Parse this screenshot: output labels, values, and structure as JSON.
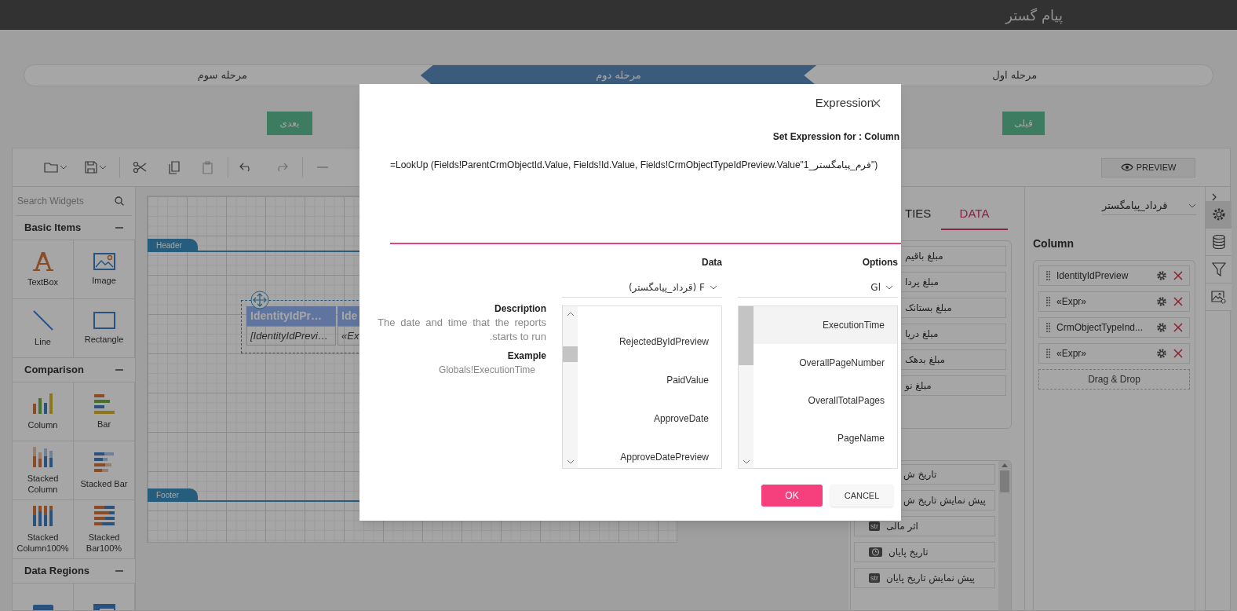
{
  "app_title": "پیام گستر",
  "steps": [
    {
      "label": "مرحله اول",
      "selected": false
    },
    {
      "label": "مرحله دوم",
      "selected": true
    },
    {
      "label": "مرحله سوم",
      "selected": false
    }
  ],
  "nav_buttons": {
    "next": "بعدی",
    "previous": "قبلی"
  },
  "toolbar": {
    "preview_button": "PREVIEW"
  },
  "widgets": {
    "search_placeholder": "Search Widgets",
    "groups": [
      {
        "title": "Basic Items",
        "expanded": true,
        "items": [
          {
            "kind": "textbox",
            "label": "TextBox"
          },
          {
            "kind": "image",
            "label": "Image"
          },
          {
            "kind": "line",
            "label": "Line"
          },
          {
            "kind": "rectangle",
            "label": "Rectangle"
          }
        ]
      },
      {
        "title": "Comparison",
        "expanded": true,
        "items": [
          {
            "kind": "column",
            "label": "Column"
          },
          {
            "kind": "bar",
            "label": "Bar"
          },
          {
            "kind": "stacked_column",
            "label": "Stacked Column"
          },
          {
            "kind": "stacked_bar",
            "label": "Stacked Bar"
          },
          {
            "kind": "stacked_column100",
            "label": "Stacked Column100%"
          },
          {
            "kind": "stacked_bar100",
            "label": "Stacked Bar100%"
          }
        ]
      },
      {
        "title": "Data Regions",
        "expanded": true,
        "items": [
          {
            "kind": "table"
          },
          {
            "kind": "list"
          }
        ]
      }
    ]
  },
  "canvas": {
    "header_band": "Header",
    "footer_band": "Footer",
    "table": {
      "header_cells": [
        "IdentityIdPr…",
        "Ide"
      ],
      "body_cells": [
        "[IdentityIdPrevi…",
        "«Ex"
      ]
    }
  },
  "properties": {
    "tabs": [
      {
        "label": "TIES",
        "selected": false
      },
      {
        "label": "DATA",
        "selected": true
      }
    ],
    "fields": [
      "مبلغ باقیم",
      "مبلغ پردا",
      "مبلغ بستانک",
      "مبلغ دریا",
      "مبلغ بدهک",
      "مبلغ نو"
    ],
    "field_types": [
      {
        "label": "تاریخ ش"
      },
      {
        "label": "پیش نمایش تاریخ ش"
      },
      {
        "label": "اثر مالی",
        "kind": "text",
        "badge": "str"
      },
      {
        "label": "تاریخ پایان",
        "kind": "date"
      },
      {
        "label": "پیش نمایش تاریخ پایان",
        "kind": "text",
        "badge": "str"
      }
    ]
  },
  "column_panel": {
    "dataset": "قرداد_پیامگستر",
    "title": "Column",
    "items": [
      "IdentityIdPreview",
      "«Expr»",
      "CrmObjectTypeInd...",
      "«Expr»"
    ],
    "drop_zone": "Drag & Drop"
  },
  "rail": [
    {
      "kind": "settings",
      "selected": true
    },
    {
      "kind": "database",
      "selected": false
    },
    {
      "kind": "filter",
      "selected": false
    },
    {
      "kind": "image",
      "selected": false
    }
  ],
  "dialog": {
    "title": "Expression",
    "subtitle": "Set Expression for : Column",
    "expression": "=LookUp (Fields!ParentCrmObjectId.Value, Fields!Id.Value, Fields!CrmObjectTypeIdPreview.Value\"فرم_پیامگستر_1\")",
    "description_title": "Description",
    "description": "The date and time that the reports starts to run.",
    "example_title": "Example",
    "example": "Globals!ExecutionTime",
    "data": {
      "title": "Data",
      "dropdown": "(قرداد_پیامگستر) F",
      "items": [
        {
          "label": "RejectedByIdPreview",
          "selected": false
        },
        {
          "label": "PaidValue",
          "selected": false
        },
        {
          "label": "ApproveDate",
          "selected": false
        },
        {
          "label": "ApproveDatePreview",
          "selected": false
        }
      ]
    },
    "options": {
      "title": "Options",
      "dropdown": "Gl",
      "items": [
        {
          "label": "ExecutionTime",
          "selected": true
        },
        {
          "label": "OverallPageNumber",
          "selected": false
        },
        {
          "label": "OverallTotalPages",
          "selected": false
        },
        {
          "label": "PageName",
          "selected": false
        }
      ]
    },
    "ok_button": "OK",
    "cancel_button": "CANCEL"
  }
}
